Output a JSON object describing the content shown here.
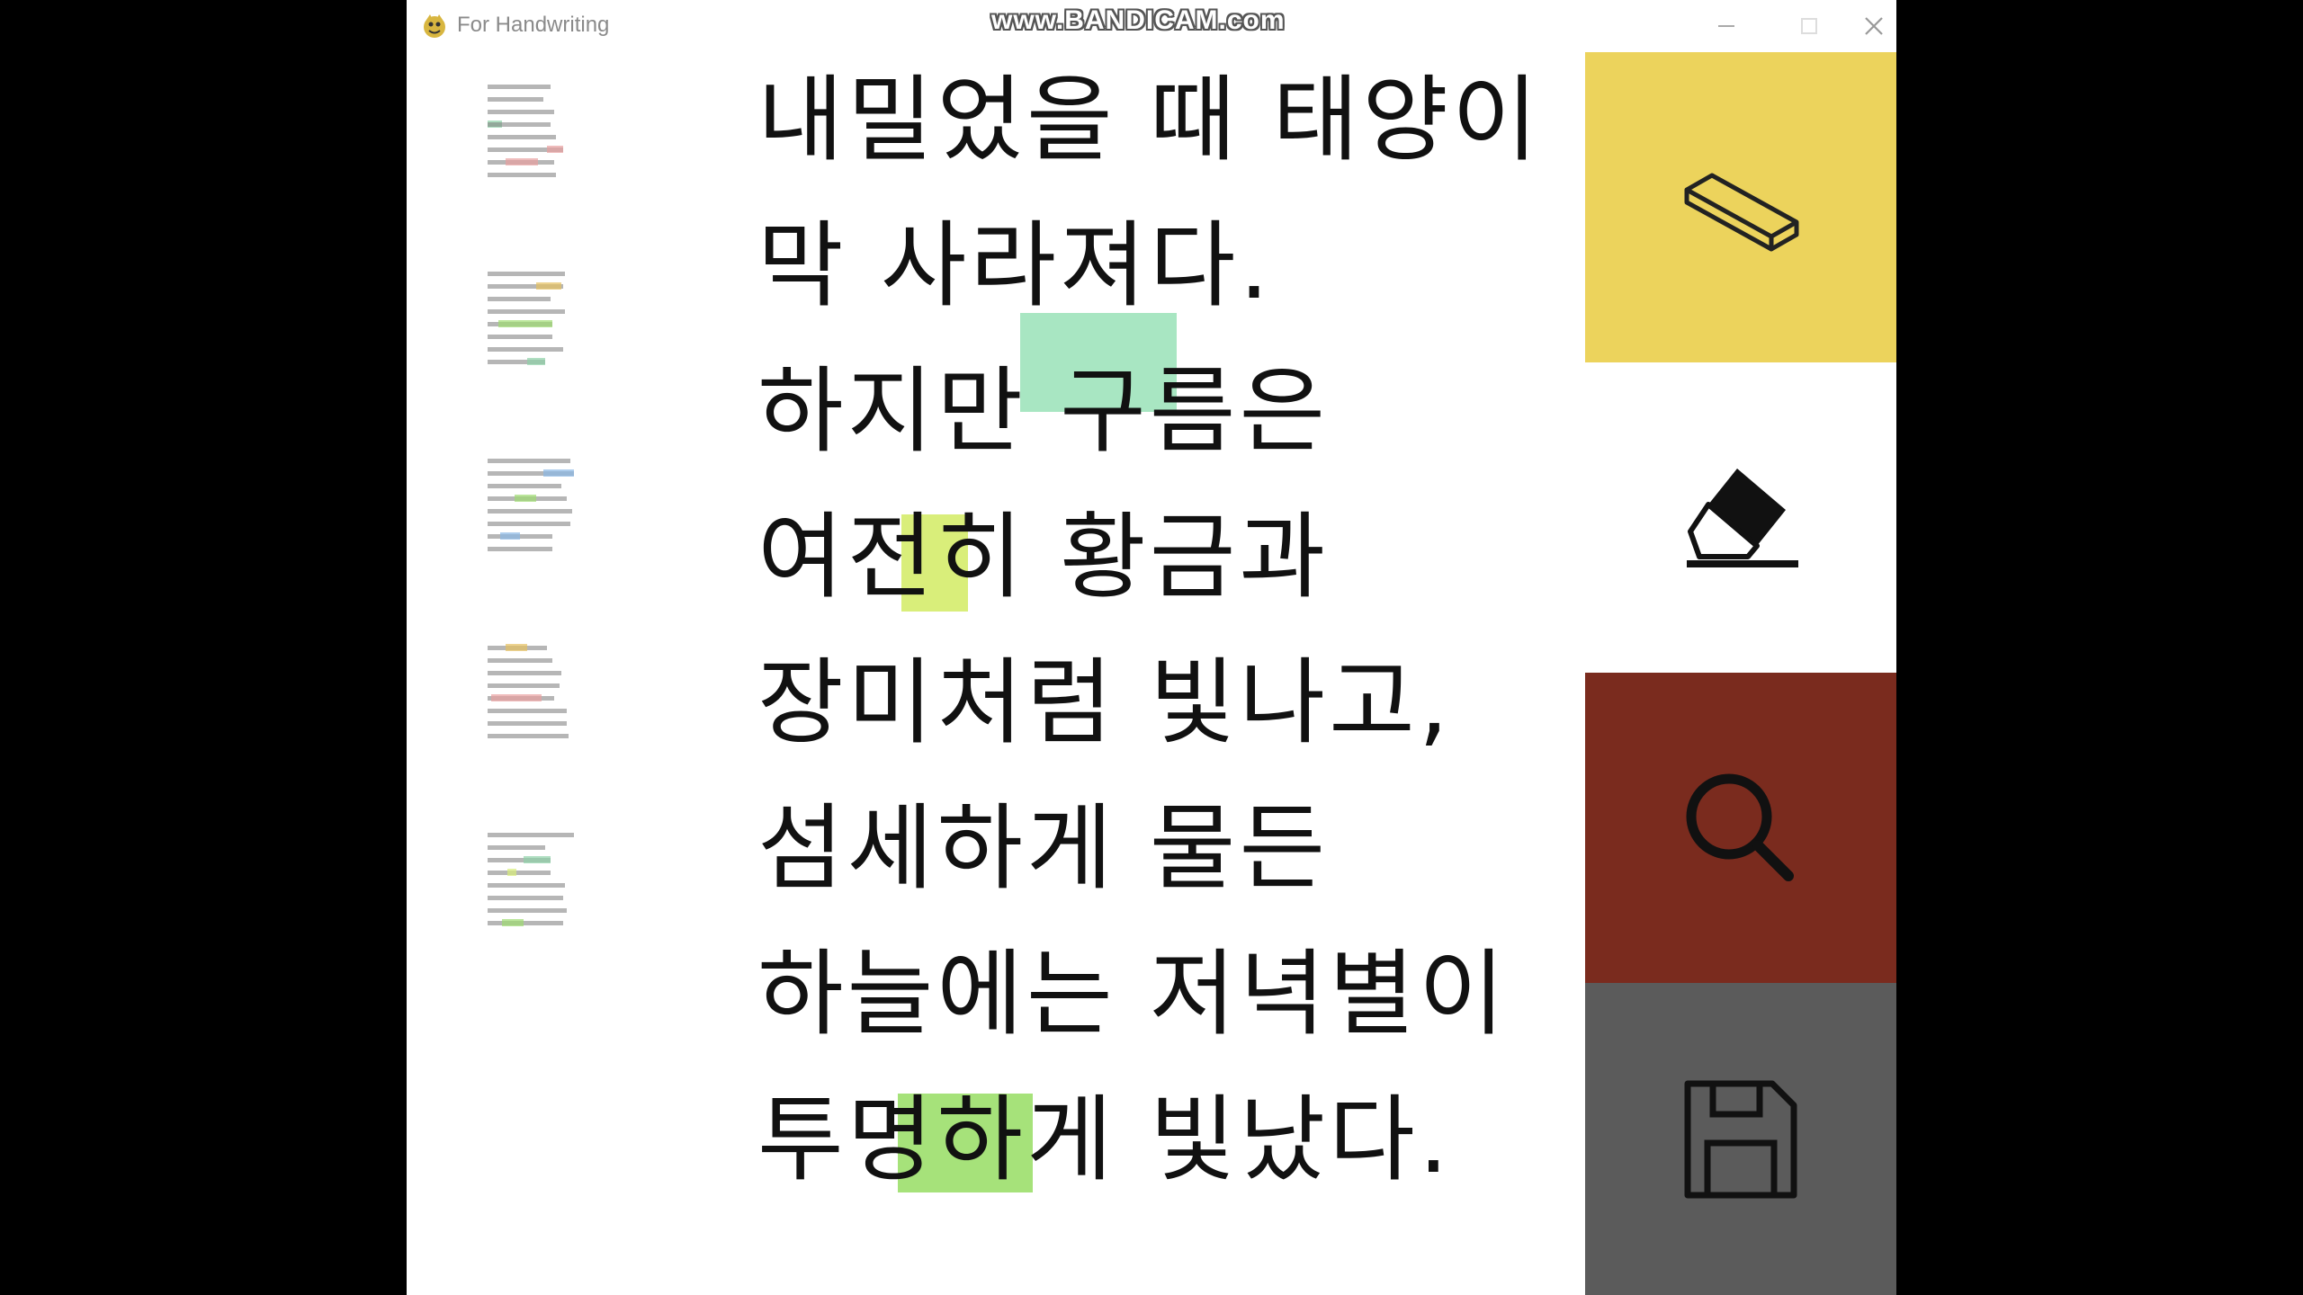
{
  "window": {
    "title": "For Handwriting",
    "watermark": "www.BANDICAM.com"
  },
  "text_lines": [
    "내밀었을 때 태양이",
    "막 사라져다.",
    "하지만 구름은",
    "여전히 황금과",
    "장미처럼 빛나고,",
    "섬세하게 물든",
    "하늘에는 저녁별이",
    "투명하게 빛났다."
  ],
  "highlights": [
    {
      "line": 2,
      "word": "구름은",
      "color": "#a8e6c2"
    },
    {
      "line": 3,
      "word": "히",
      "color": "#d9ee7a"
    },
    {
      "line": 7,
      "word": "하게",
      "color": "#a6e27a"
    }
  ],
  "tools": [
    {
      "name": "eraser-block",
      "color": "#ecd35c"
    },
    {
      "name": "eraser",
      "color": "#ffffff"
    },
    {
      "name": "search",
      "color": "#7a2b1e"
    },
    {
      "name": "save",
      "color": "#5b5b5b"
    }
  ]
}
